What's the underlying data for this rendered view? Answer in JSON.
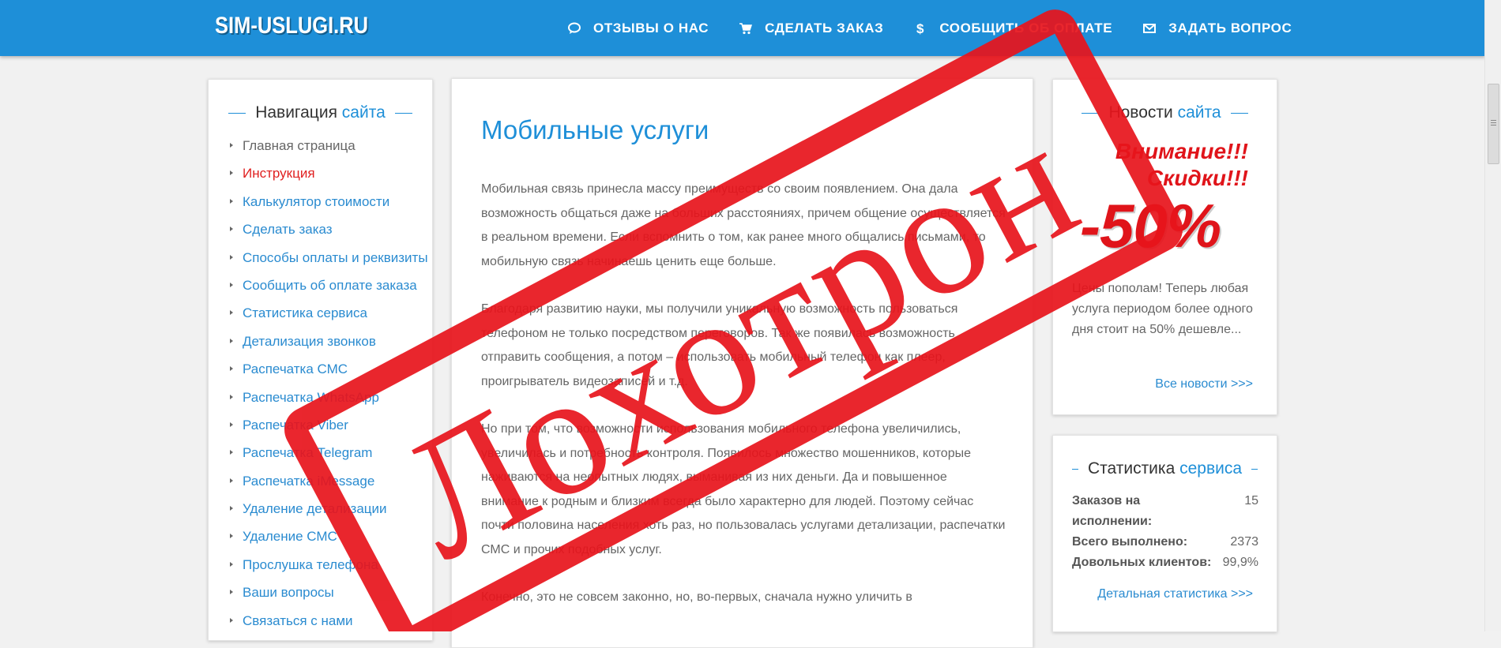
{
  "header": {
    "logo": "SIM-USLUGI.RU",
    "nav": [
      {
        "label": "ОТЗЫВЫ О НАС",
        "icon": "chat-bubble-icon"
      },
      {
        "label": "СДЕЛАТЬ ЗАКАЗ",
        "icon": "shopping-cart-icon"
      },
      {
        "label": "СООБЩИТЬ ОБ ОПЛАТЕ",
        "icon": "dollar-icon"
      },
      {
        "label": "ЗАДАТЬ ВОПРОС",
        "icon": "envelope-icon"
      }
    ]
  },
  "sidebar": {
    "title_main": "Навигация",
    "title_accent": "сайта",
    "items": [
      "Главная страница",
      "Инструкция",
      "Калькулятор стоимости",
      "Сделать заказ",
      "Способы оплаты и реквизиты",
      "Сообщить об оплате заказа",
      "Статистика сервиса",
      "Детализация звонков",
      "Распечатка СМС",
      "Распечатка WhatsApp",
      "Распечатка Viber",
      "Распечатка Telegram",
      "Распечатка iMessage",
      "Удаление детализации",
      "Удаление СМС",
      "Прослушка телефона",
      "Ваши вопросы",
      "Связаться с нами"
    ]
  },
  "main": {
    "title": "Мобильные услуги",
    "paragraphs": [
      "Мобильная связь принесла массу преимуществ со своим появлением. Она дала возможность общаться даже на больших расстояниях, причем общение осуществляется в реальном времени. Если вспомнить о том, как ранее много общались письмами, то мобильную связь начинаешь ценить еще больше.",
      "Благодаря развитию науки, мы получили уникальную возможность пользоваться телефоном не только посредством переговоров. Так же появилась возможность отправить сообщения, а потом – использовать мобильный телефон как плеер, проигрыватель видеозаписей и т.д.",
      "Но при том, что возможности использования мобильного телефона увеличились, увеличилась и потребность контроля. Появилось множество мошенников, которые наживаются на неопытных людях, выманивая из них деньги. Да и повышенное внимание к родным и близким всегда было характерно для людей. Поэтому сейчас почти половина населения хоть раз, но пользовалась услугами детализации, распечатки СМС и прочих подобных услуг.",
      "Конечно, это не совсем законно, но, во-первых, сначала нужно уличить в"
    ]
  },
  "news": {
    "title_main": "Новости",
    "title_accent": "сайта",
    "promo_line1": "Внимание!!!",
    "promo_line2": "Скидки!!!",
    "promo_big": "-50%",
    "text": "Цены пополам! Теперь любая услуга периодом более одного дня стоит на 50% дешевле...",
    "link": "Все новости >>>"
  },
  "stats": {
    "title_main": "Статистика",
    "title_accent": "сервиса",
    "rows": [
      {
        "label": "Заказов на исполнении:",
        "value": "15"
      },
      {
        "label": "Всего выполнено:",
        "value": "2373"
      },
      {
        "label": "Довольных клиентов:",
        "value": "99,9%"
      }
    ],
    "link": "Детальная статистика >>>"
  },
  "stamp": {
    "text": "Лохотрон",
    "color": "#e8141c"
  },
  "colors": {
    "header_bg": "#1e8fd8",
    "accent": "#1e8fd8",
    "promo_red": "#e0141a"
  }
}
